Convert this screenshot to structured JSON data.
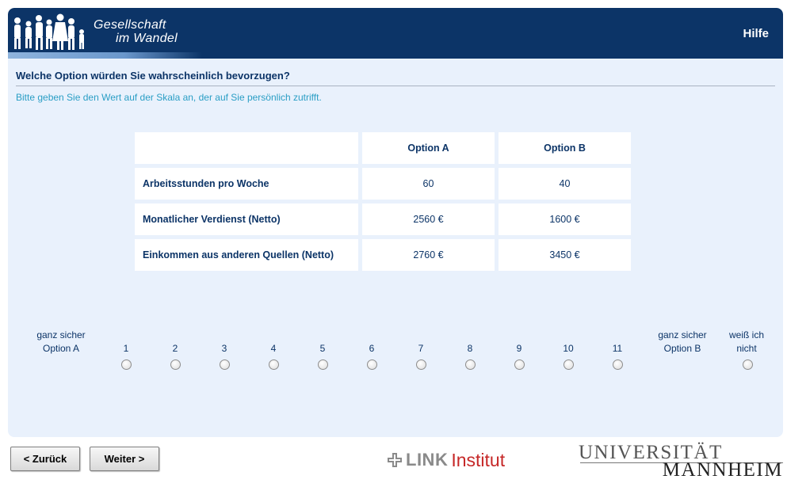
{
  "header": {
    "brand_line1": "Gesellschaft",
    "brand_line2": "im Wandel",
    "help_label": "Hilfe"
  },
  "question": "Welche Option würden Sie wahrscheinlich bevorzugen?",
  "instruction": "Bitte geben Sie den Wert auf der Skala an, der auf Sie persönlich zutrifft.",
  "table": {
    "columns": [
      "Option A",
      "Option B"
    ],
    "rows": [
      {
        "label": "Arbeitsstunden pro Woche",
        "a": "60",
        "b": "40"
      },
      {
        "label": "Monatlicher Verdienst (Netto)",
        "a": "2560 €",
        "b": "1600 €"
      },
      {
        "label": "Einkommen aus anderen Quellen (Netto)",
        "a": "2760 €",
        "b": "3450 €"
      }
    ]
  },
  "scale": {
    "left_label_1": "ganz sicher",
    "left_label_2": "Option A",
    "right_label_1": "ganz sicher",
    "right_label_2": "Option B",
    "dk_label_1": "weiß ich",
    "dk_label_2": "nicht",
    "points": [
      "1",
      "2",
      "3",
      "4",
      "5",
      "6",
      "7",
      "8",
      "9",
      "10",
      "11"
    ]
  },
  "nav": {
    "back_label": "< Zurück",
    "next_label": "Weiter >"
  },
  "footer": {
    "link_brand": "LINK",
    "link_suffix": "Institut",
    "uni_line1": "UNIVERSITÄT",
    "uni_line2": "MANNHEIM"
  },
  "colors": {
    "header_bg": "#0c3467",
    "panel_bg": "#e9f1fc",
    "instruction_text": "#2a9ec5",
    "link_red": "#c62828"
  }
}
